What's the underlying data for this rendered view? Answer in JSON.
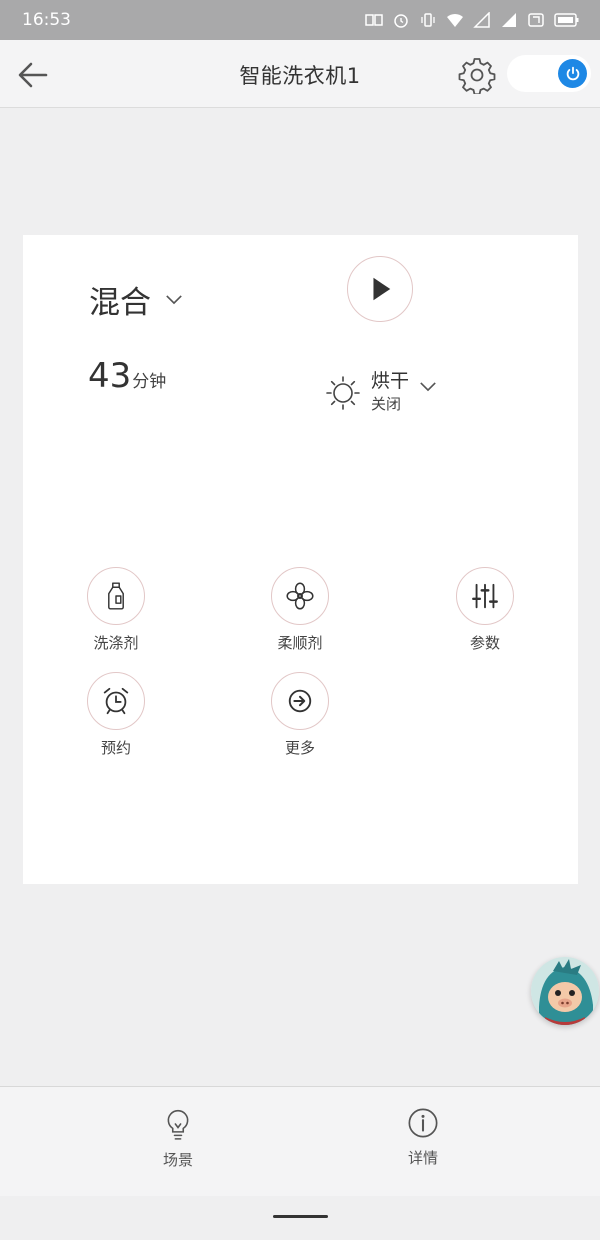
{
  "status_bar": {
    "time": "16:53"
  },
  "header": {
    "title": "智能洗衣机1"
  },
  "power": {
    "on": true,
    "accent": "#1e88e5"
  },
  "program": {
    "mode": "混合",
    "duration_value": "43",
    "duration_unit": "分钟",
    "dry_label": "烘干",
    "dry_status": "关闭"
  },
  "functions": [
    {
      "label": "洗涤剂",
      "icon": "detergent-bottle-icon"
    },
    {
      "label": "柔顺剂",
      "icon": "flower-icon"
    },
    {
      "label": "参数",
      "icon": "sliders-icon"
    },
    {
      "label": "预约",
      "icon": "alarm-clock-icon"
    },
    {
      "label": "更多",
      "icon": "arrow-right-circle-icon"
    }
  ],
  "bottom_nav": {
    "items": [
      {
        "label": "场景",
        "icon": "lightbulb-icon"
      },
      {
        "label": "详情",
        "icon": "info-icon"
      }
    ]
  },
  "colors": {
    "background": "#efeff0",
    "card": "#ffffff",
    "status_bar": "#a9a9aa",
    "circle_border": "#e2c7c7"
  }
}
